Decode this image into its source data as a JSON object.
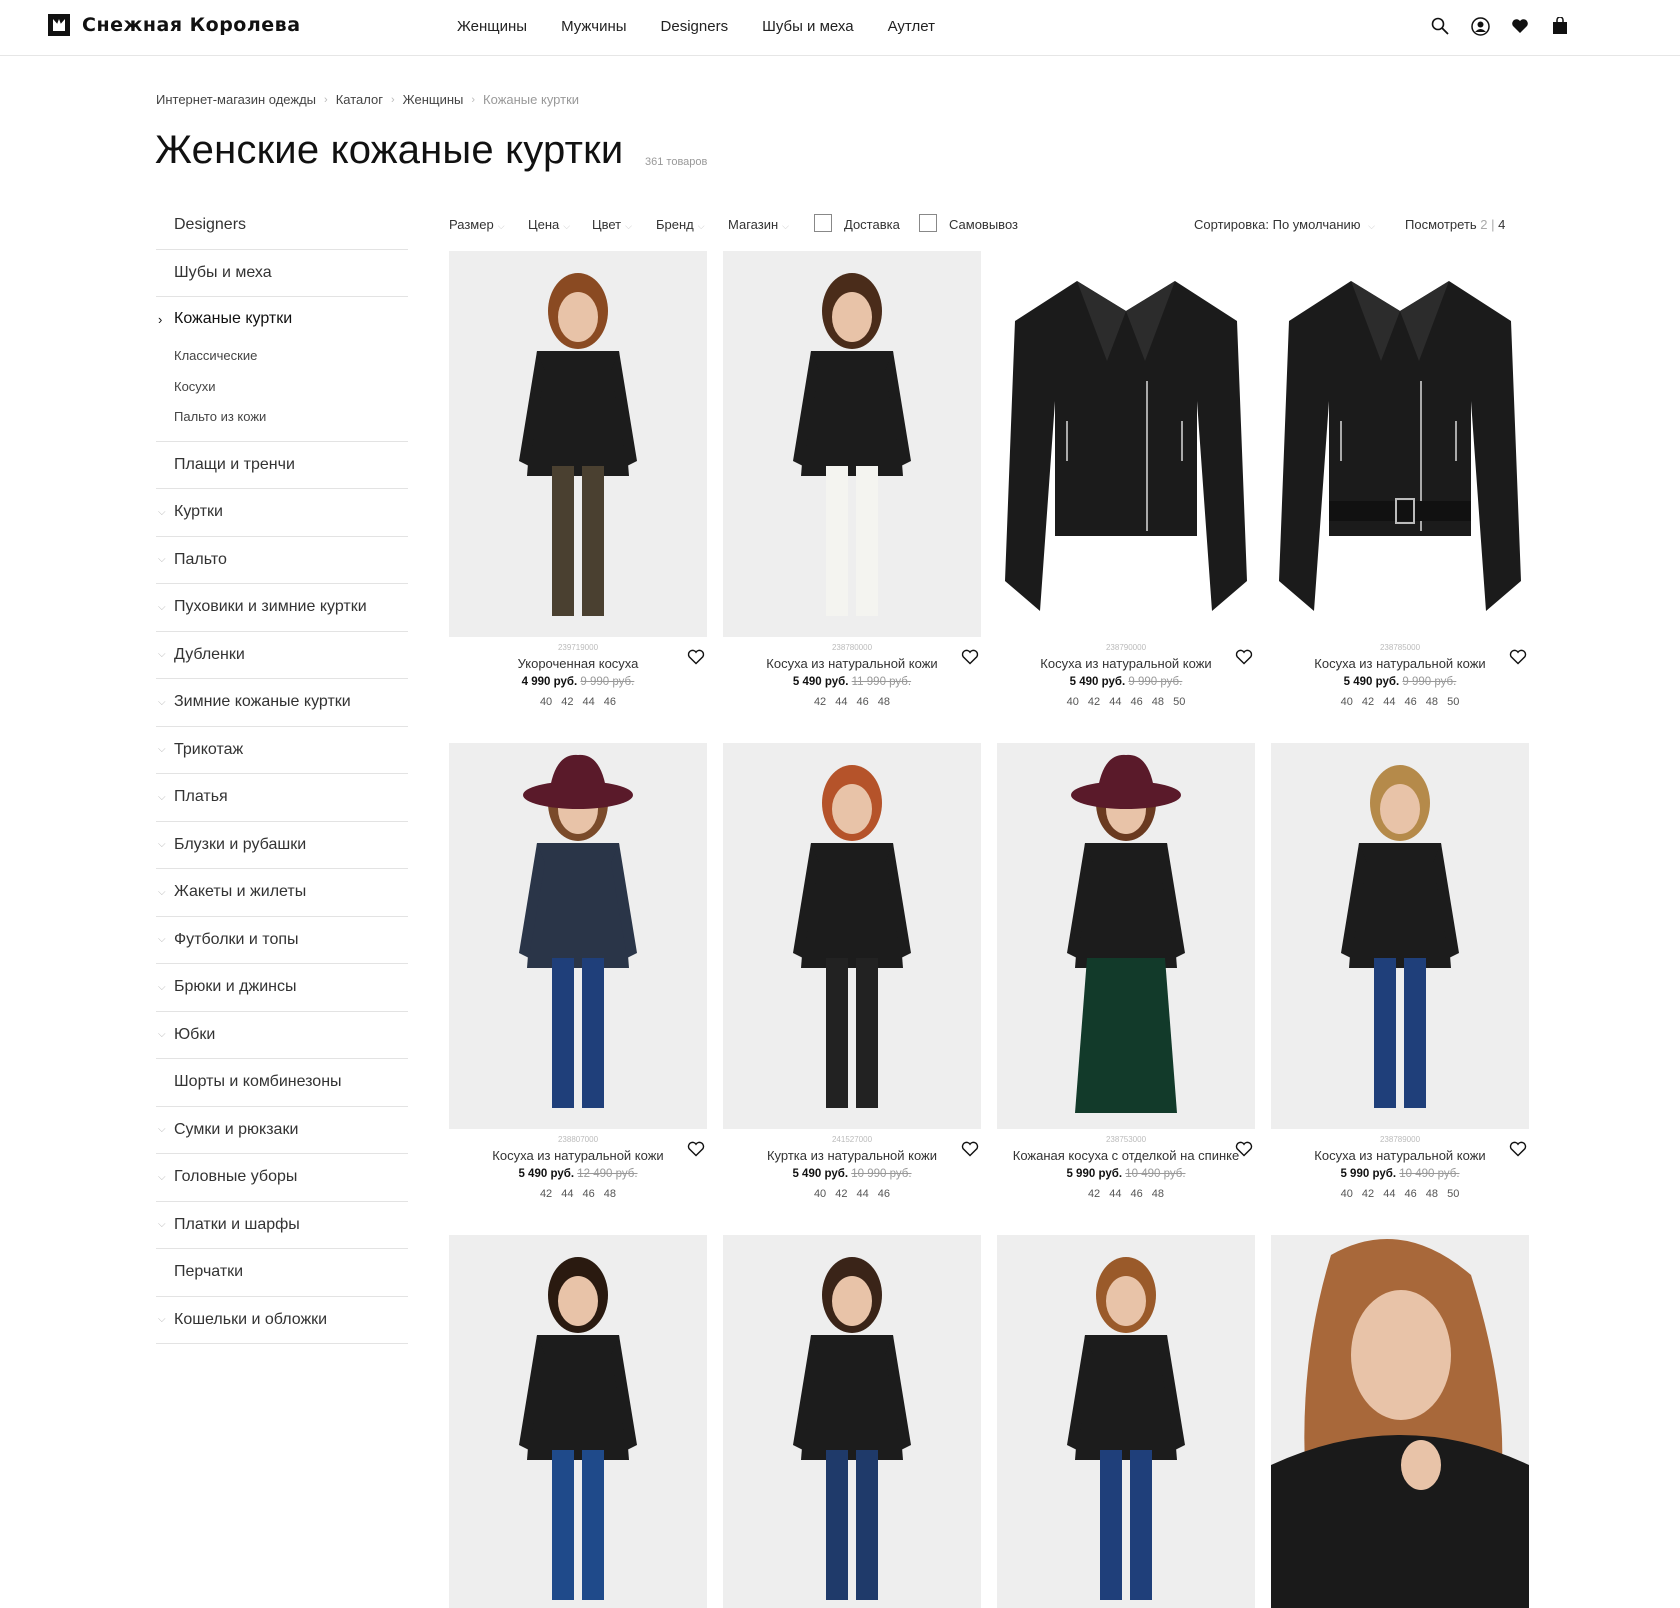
{
  "header": {
    "logo_text": "Снежная Королева",
    "nav": [
      "Женщины",
      "Мужчины",
      "Designers",
      "Шубы и меха",
      "Аутлет"
    ],
    "icons": [
      "search-icon",
      "user-icon",
      "heart-icon",
      "bag-icon"
    ]
  },
  "breadcrumb": [
    "Интернет-магазин одежды",
    "Каталог",
    "Женщины",
    "Кожаные куртки"
  ],
  "title": "Женские кожаные куртки",
  "count": "361 товаров",
  "sidebar": {
    "items_before": [
      "Designers",
      "Шубы и меха"
    ],
    "active": "Кожаные куртки",
    "sub": [
      "Классические",
      "Косухи",
      "Пальто из кожи"
    ],
    "items_after": [
      "Плащи и тренчи",
      "Куртки",
      "Пальто",
      "Пуховики и зимние куртки",
      "Дубленки",
      "Зимние кожаные куртки",
      "Трикотаж",
      "Платья",
      "Блузки и рубашки",
      "Жакеты и жилеты",
      "Футболки и топы",
      "Брюки и джинсы",
      "Юбки",
      "Шорты и комбинезоны",
      "Сумки и рюкзаки",
      "Головные уборы",
      "Платки и шарфы",
      "Перчатки",
      "Кошельки и обложки"
    ]
  },
  "filters": {
    "size": "Размер",
    "price": "Цена",
    "color": "Цвет",
    "brand": "Бренд",
    "store": "Магазин",
    "delivery": "Доставка",
    "pickup": "Самовывоз",
    "sort_label": "Сортировка:",
    "sort_value": "По умолчанию",
    "view_label": "Посмотреть",
    "view_2": "2",
    "view_sep": "|",
    "view_4": "4"
  },
  "products": [
    {
      "sku": "239719000",
      "name": "Укороченная косуха",
      "price": "4 990 руб.",
      "old_price": "9 990 руб.",
      "sizes": "40 42 44 46",
      "style": "model-leopard"
    },
    {
      "sku": "238780000",
      "name": "Косуха из натуральной кожи",
      "price": "5 490 руб.",
      "old_price": "11 990 руб.",
      "sizes": "42 44 46 48",
      "style": "model-white"
    },
    {
      "sku": "238790000",
      "name": "Косуха из натуральной кожи",
      "price": "5 490 руб.",
      "old_price": "9 990 руб.",
      "sizes": "40 42 44 46 48 50",
      "style": "jacket-flat"
    },
    {
      "sku": "238785000",
      "name": "Косуха из натуральной кожи",
      "price": "5 490 руб.",
      "old_price": "9 990 руб.",
      "sizes": "40 42 44 46 48 50",
      "style": "jacket-belt"
    },
    {
      "sku": "238807000",
      "name": "Косуха из натуральной кожи",
      "price": "5 490 руб.",
      "old_price": "12 490 руб.",
      "sizes": "42 44 46 48",
      "style": "model-hat-navy"
    },
    {
      "sku": "241527000",
      "name": "Куртка из натуральной кожи",
      "price": "5 490 руб.",
      "old_price": "10 990 руб.",
      "sizes": "40 42 44 46",
      "style": "model-seated"
    },
    {
      "sku": "238753000",
      "name": "Кожаная косуха с отделкой на спинке",
      "price": "5 990 руб.",
      "old_price": "10 490 руб.",
      "sizes": "42 44 46 48",
      "style": "model-hat-green"
    },
    {
      "sku": "238789000",
      "name": "Косуха из натуральной кожи",
      "price": "5 990 руб.",
      "old_price": "10 490 руб.",
      "sizes": "40 42 44 46 48 50",
      "style": "model-jeans-bag"
    },
    {
      "sku": "",
      "name": "",
      "price": "",
      "old_price": "",
      "sizes": "",
      "style": "model-yellow"
    },
    {
      "sku": "",
      "name": "",
      "price": "",
      "old_price": "",
      "sizes": "",
      "style": "model-backpack"
    },
    {
      "sku": "",
      "name": "",
      "price": "",
      "old_price": "",
      "sizes": "",
      "style": "model-curly"
    },
    {
      "sku": "",
      "name": "",
      "price": "",
      "old_price": "",
      "sizes": "",
      "style": "model-closeup"
    }
  ],
  "colors": {
    "text": "#222222",
    "muted": "#999999",
    "border": "#e3e3e3",
    "photo_bg": "#eeeeee"
  }
}
